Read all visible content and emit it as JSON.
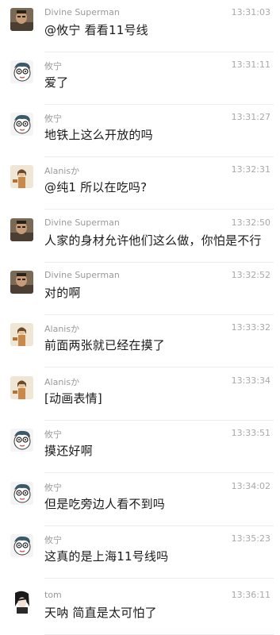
{
  "messages": [
    {
      "sender": "Divine Superman",
      "time": "13:31:03",
      "text": "@攸宁 看看11号线",
      "avatar": "avatar-divine-superman"
    },
    {
      "sender": "攸宁",
      "time": "13:31:11",
      "text": "爱了",
      "avatar": "avatar-youning"
    },
    {
      "sender": "攸宁",
      "time": "13:31:27",
      "text": "地铁上这么开放的吗",
      "avatar": "avatar-youning"
    },
    {
      "sender": "Alanisか",
      "time": "13:32:31",
      "text": "@纯1 所以在吃吗?",
      "avatar": "avatar-alanis"
    },
    {
      "sender": "Divine Superman",
      "time": "13:32:50",
      "text": "人家的身材允许他们这么做，你怕是不行",
      "avatar": "avatar-divine-superman"
    },
    {
      "sender": "Divine Superman",
      "time": "13:32:52",
      "text": "对的啊",
      "avatar": "avatar-divine-superman"
    },
    {
      "sender": "Alanisか",
      "time": "13:33:32",
      "text": "前面两张就已经在摸了",
      "avatar": "avatar-alanis"
    },
    {
      "sender": "Alanisか",
      "time": "13:33:34",
      "text": "[动画表情]",
      "avatar": "avatar-alanis"
    },
    {
      "sender": "攸宁",
      "time": "13:33:51",
      "text": "摸还好啊",
      "avatar": "avatar-youning"
    },
    {
      "sender": "攸宁",
      "time": "13:34:02",
      "text": "但是吃旁边人看不到吗",
      "avatar": "avatar-youning"
    },
    {
      "sender": "攸宁",
      "time": "13:35:23",
      "text": "这真的是上海11号线吗",
      "avatar": "avatar-youning"
    },
    {
      "sender": "tom",
      "time": "13:36:11",
      "text": "天呐 简直是太可怕了",
      "avatar": "avatar-tom"
    }
  ]
}
